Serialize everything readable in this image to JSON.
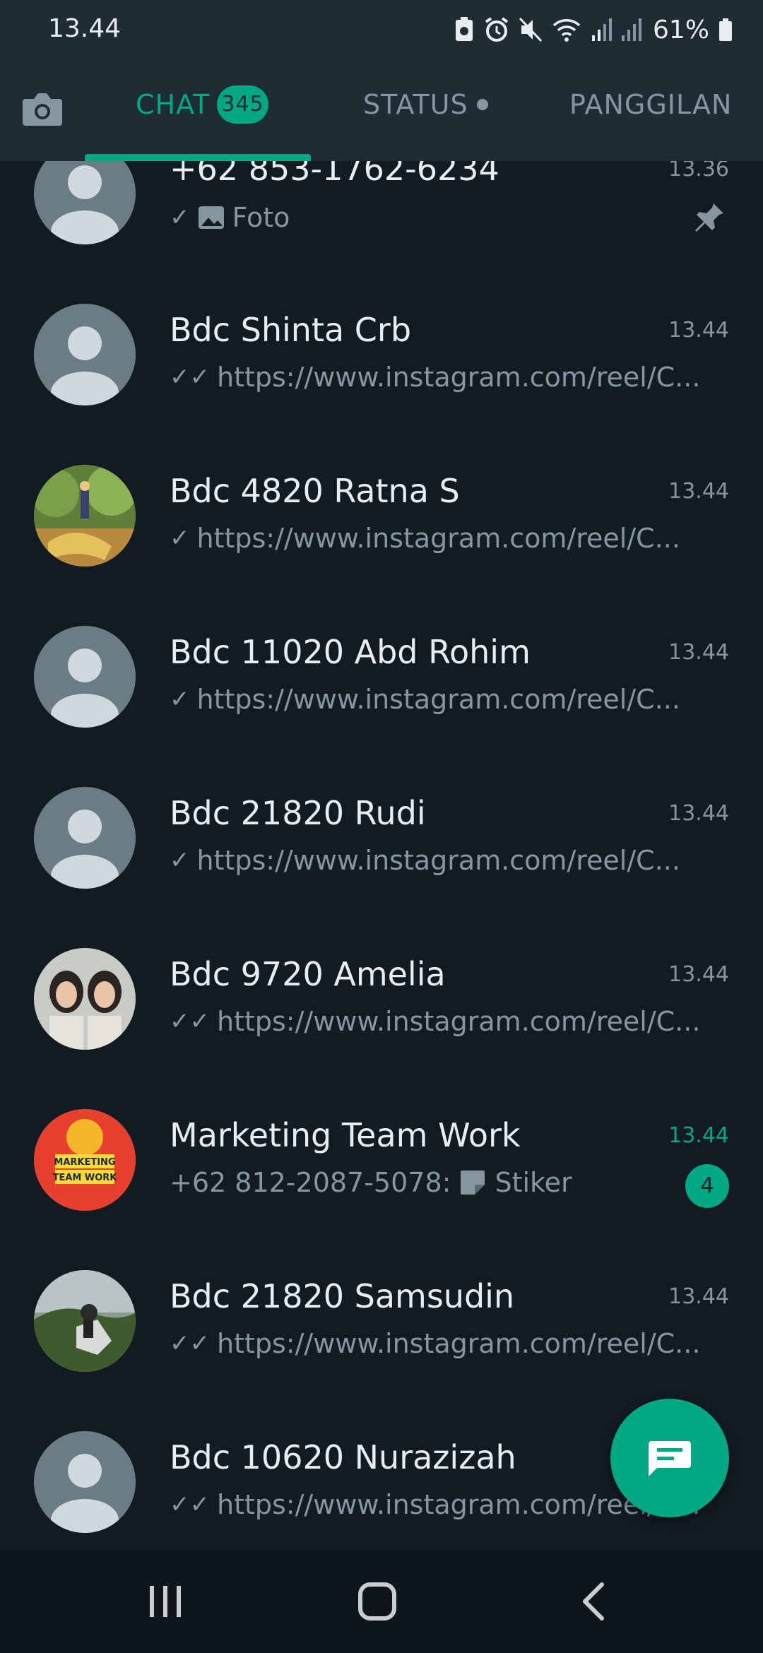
{
  "status_bar": {
    "time": "13.44",
    "battery": "61%"
  },
  "tabs": {
    "chat": "CHAT",
    "chat_badge": "345",
    "status": "STATUS",
    "calls": "PANGGILAN",
    "active": "chat"
  },
  "chats": [
    {
      "name": "+62 853-1762-6234",
      "time": "13.36",
      "preview": "Foto",
      "tick": "single",
      "media": "photo",
      "pinned": true,
      "avatar": "default"
    },
    {
      "name": "Bdc Shinta Crb",
      "time": "13.44",
      "preview": "https://www.instagram.com/reel/C...",
      "tick": "double",
      "avatar": "default"
    },
    {
      "name": "Bdc 4820 Ratna S",
      "time": "13.44",
      "preview": "https://www.instagram.com/reel/C...",
      "tick": "single",
      "avatar": "photo-outdoor"
    },
    {
      "name": "Bdc 11020 Abd Rohim",
      "time": "13.44",
      "preview": "https://www.instagram.com/reel/C...",
      "tick": "single",
      "avatar": "default"
    },
    {
      "name": "Bdc 21820 Rudi",
      "time": "13.44",
      "preview": "https://www.instagram.com/reel/C...",
      "tick": "single",
      "avatar": "default"
    },
    {
      "name": "Bdc 9720 Amelia",
      "time": "13.44",
      "preview": "https://www.instagram.com/reel/C...",
      "tick": "double",
      "avatar": "photo-portrait"
    },
    {
      "name": "Marketing Team Work",
      "time": "13.44",
      "preview_sender": "+62 812-2087-5078:",
      "preview": "Stiker",
      "media": "sticker",
      "unread": "4",
      "avatar": "group-logo"
    },
    {
      "name": "Bdc 21820 Samsudin",
      "time": "13.44",
      "preview": "https://www.instagram.com/reel/C...",
      "tick": "double",
      "avatar": "photo-motorbike"
    },
    {
      "name": "Bdc 10620 Nurazizah",
      "time": "",
      "preview": "https://www.instagram.com/reel/C...",
      "tick": "double",
      "avatar": "default"
    }
  ],
  "group_logo_text": [
    "MARKETING",
    "TEAM WORK"
  ],
  "colors": {
    "accent": "#00a884",
    "header": "#1f2c34",
    "background": "#121b22",
    "muted": "#8696a0"
  },
  "icons": [
    "camera-icon",
    "pin-icon",
    "new-chat-icon",
    "recents-icon",
    "home-icon",
    "back-icon"
  ]
}
